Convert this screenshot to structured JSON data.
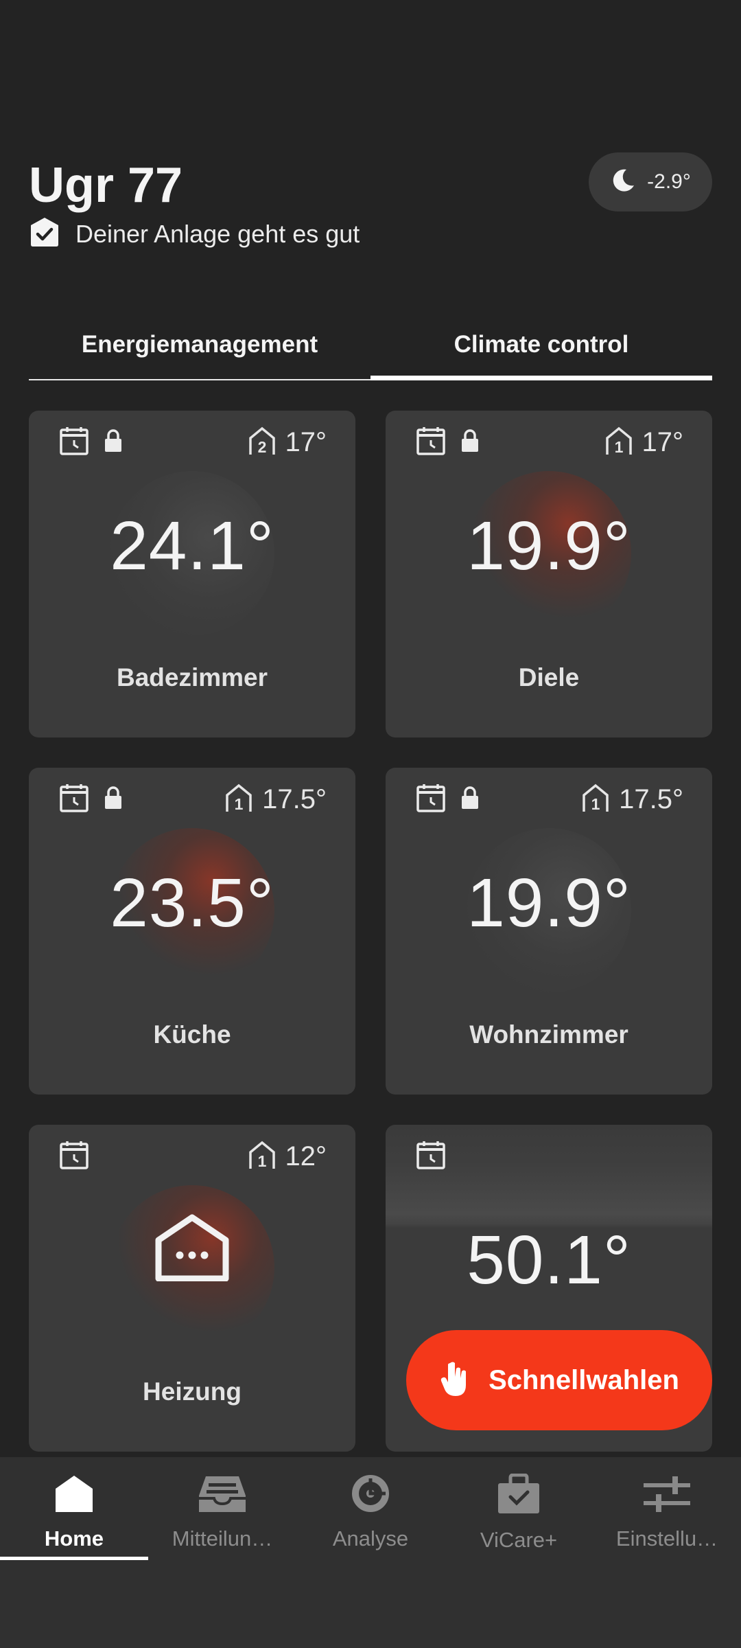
{
  "header": {
    "title": "Ugr 77",
    "status_text": "Deiner Anlage geht es gut",
    "outdoor_temp": "-2.9°"
  },
  "tabs": [
    {
      "label": "Energiemanagement",
      "active": false
    },
    {
      "label": "Climate control",
      "active": true
    }
  ],
  "cards": [
    {
      "name": "Badezimmer",
      "temp": "24.1°",
      "zone": "2",
      "setpoint": "17°",
      "locked": true,
      "glow": "grey"
    },
    {
      "name": "Diele",
      "temp": "19.9°",
      "zone": "1",
      "setpoint": "17°",
      "locked": true,
      "glow": "red"
    },
    {
      "name": "Küche",
      "temp": "23.5°",
      "zone": "1",
      "setpoint": "17.5°",
      "locked": true,
      "glow": "red"
    },
    {
      "name": "Wohnzimmer",
      "temp": "19.9°",
      "zone": "1",
      "setpoint": "17.5°",
      "locked": true,
      "glow": "grey"
    },
    {
      "name": "Heizung",
      "zone": "1",
      "setpoint": "12°",
      "icon": "house-more-icon",
      "glow": "red"
    },
    {
      "temp": "50.1°",
      "icon": "schedule-icon"
    }
  ],
  "fab": {
    "label": "Schnellwahlen",
    "icon": "hand-pointer-icon"
  },
  "bottom_nav": [
    {
      "label": "Home",
      "icon": "home-icon",
      "active": true
    },
    {
      "label": "Mitteilun…",
      "icon": "inbox-icon",
      "active": false
    },
    {
      "label": "Analyse",
      "icon": "analysis-icon",
      "active": false
    },
    {
      "label": "ViCare+",
      "icon": "bag-check-icon",
      "active": false
    },
    {
      "label": "Einstellu…",
      "icon": "sliders-icon",
      "active": false
    }
  ],
  "colors": {
    "background": "#232323",
    "card": "#3b3b3b",
    "accent": "#f4381a",
    "nav": "#303030"
  }
}
